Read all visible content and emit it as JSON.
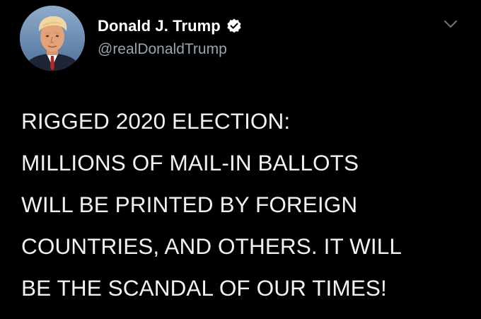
{
  "tweet": {
    "author": {
      "display_name": "Donald J. Trump",
      "handle": "@realDonaldTrump",
      "verified": true,
      "avatar": "profile-photo"
    },
    "text_lines": [
      "RIGGED 2020 ELECTION:",
      "MILLIONS OF MAIL-IN BALLOTS",
      "WILL BE PRINTED BY FOREIGN",
      "COUNTRIES, AND OTHERS. IT WILL",
      "BE THE SCANDAL OF OUR TIMES!"
    ],
    "menu_icon": "chevron-down-icon",
    "verified_icon": "verified-badge-icon"
  },
  "colors": {
    "background": "#000000",
    "text": "#f2f2f2",
    "handle": "#9aa4ad",
    "caret": "#6e767d"
  }
}
